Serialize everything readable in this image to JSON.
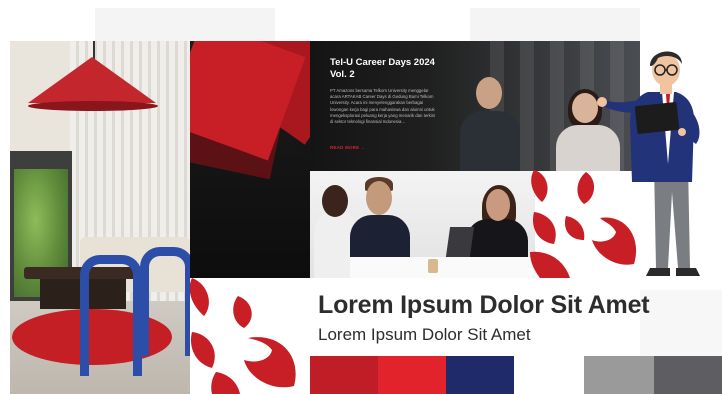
{
  "career_card": {
    "title": "Tel-U Career Days 2024 Vol. 2",
    "body": "PT Amazons bersama Telkom University menggelar acara ARTAKAB Career Days di Gedung Bumi Telkom University. Acara ini menyelenggarakan berbagai lowongan kerja bagi para mahasiswa dan alumni untuk mengeksplorasi peluang kerja yang menarik dan terkini di sektor teknologi finansial Indonesia...",
    "link": "READ MORE  →"
  },
  "headline": "Lorem Ipsum Dolor Sit Amet",
  "subheadline": "Lorem Ipsum Dolor Sit Amet",
  "colors": {
    "brand_red": "#c81e25",
    "navy": "#1f2a6b",
    "swatches": [
      "#bf1e26",
      "#e3232b",
      "#1f2a6b",
      "#ffffff",
      "#9a9a9a",
      "#5e5e62"
    ]
  },
  "icons": {
    "logo_mark": "telkom-leaf-logo",
    "presenter": "presenter-illustration"
  }
}
